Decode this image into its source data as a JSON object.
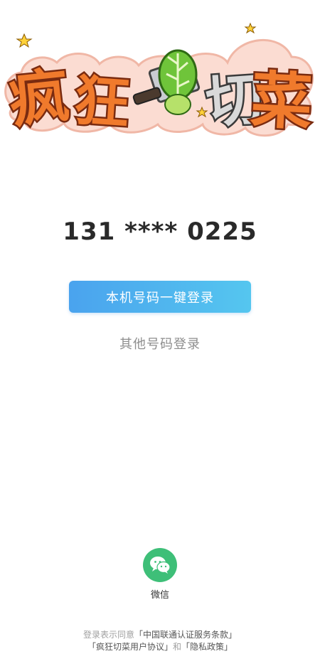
{
  "logo": {
    "chars": [
      "疯",
      "狂",
      "切",
      "菜"
    ],
    "accent": "#f07a2c",
    "outline": "#7a2b10"
  },
  "phone": {
    "masked_number": "131 **** 0225"
  },
  "buttons": {
    "one_click_login": "本机号码一键登录",
    "other_number_login": "其他号码登录"
  },
  "wechat": {
    "label": "微信",
    "icon": "wechat-icon",
    "color": "#3ebf78"
  },
  "terms": {
    "prefix": "登录表示同意",
    "service_terms": "「中国联通认证服务条款」",
    "user_agreement": "「疯狂切菜用户协议」",
    "and": "和",
    "privacy_policy": "「隐私政策」"
  }
}
